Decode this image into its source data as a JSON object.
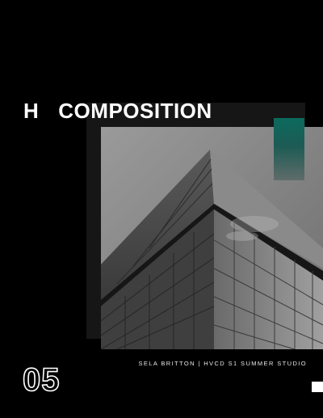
{
  "heading": {
    "prefix": "H",
    "title": "COMPOSITION"
  },
  "credit": "SELA BRITTON | HVCD S1 SUMMER STUDIO",
  "page_number": "05",
  "colors": {
    "background": "#000000",
    "panel": "#161616",
    "accent_top": "#0b6a5d",
    "text": "#ffffff"
  }
}
